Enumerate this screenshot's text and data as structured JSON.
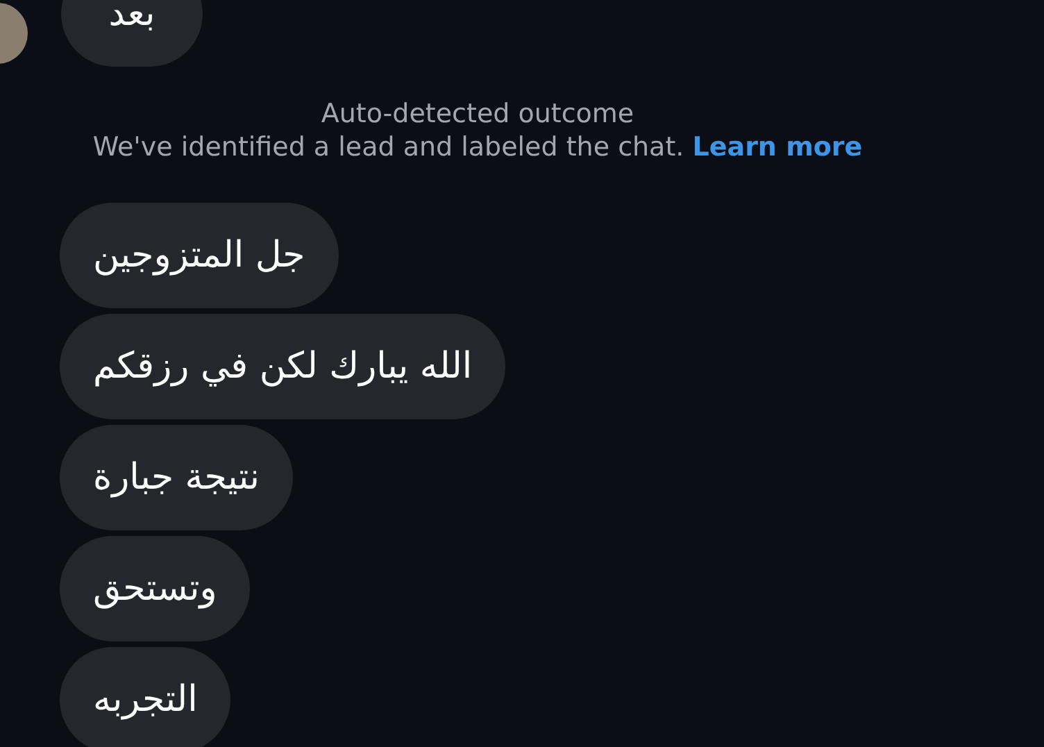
{
  "messages_before": [
    {
      "text": "بعد"
    }
  ],
  "notice": {
    "title": "Auto-detected outcome",
    "text": "We've identified a lead and labeled the chat.",
    "link": "Learn more"
  },
  "messages_after": [
    {
      "text": "جل المتزوجين"
    },
    {
      "text": "الله يبارك لكن في رزقكم"
    },
    {
      "text": "نتيجة جبارة"
    },
    {
      "text": "وتستحق"
    },
    {
      "text": "التجربه"
    }
  ]
}
